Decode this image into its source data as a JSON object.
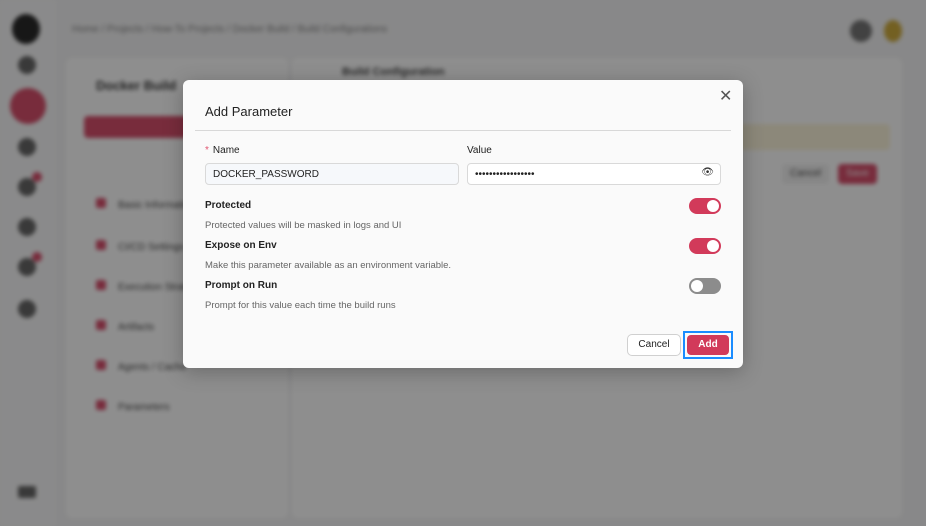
{
  "background": {
    "breadcrumb": "Home / Projects / How-To Projects / Docker Build / Build Configurations",
    "project_title": "Docker Build",
    "section_title": "Build Configuration",
    "nav_items": [
      "Basic Information",
      "CI/CD Settings",
      "Execution Strategy",
      "Artifacts",
      "Agents / Cache",
      "Parameters"
    ],
    "cancel_label": "Cancel",
    "save_label": "Save"
  },
  "dialog": {
    "title": "Add Parameter",
    "close_icon": "close-icon",
    "name_label": "Name",
    "name_required": "*",
    "name_value": "DOCKER_PASSWORD",
    "value_label": "Value",
    "value_masked": "•••••••••••••••••",
    "toggles": [
      {
        "title": "Protected",
        "description": "Protected values will be masked in logs and UI",
        "on": true
      },
      {
        "title": "Expose on Env",
        "description": "Make this parameter available as an environment variable.",
        "on": true
      },
      {
        "title": "Prompt on Run",
        "description": "Prompt for this value each time the build runs",
        "on": false
      }
    ],
    "cancel_label": "Cancel",
    "add_label": "Add",
    "accent_color": "#d23a5a"
  }
}
